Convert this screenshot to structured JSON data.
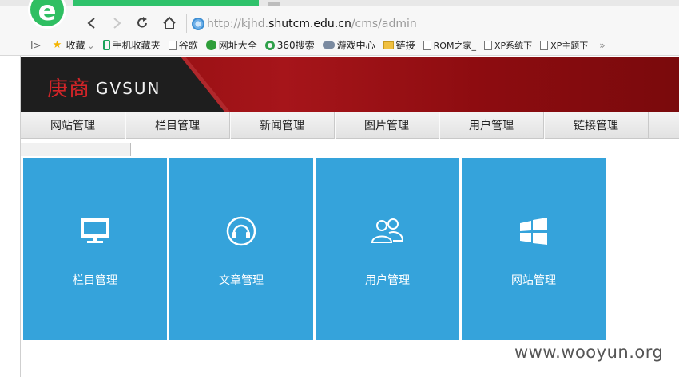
{
  "browser": {
    "back_icon": "chevron-left-icon",
    "forward_icon": "chevron-right-icon",
    "refresh_icon": "refresh-icon",
    "home_icon": "home-icon",
    "url_scheme": "http://",
    "url_sub": "kjhd.",
    "url_domain": "shutcm.edu.cn",
    "url_path": "/cms/admin"
  },
  "favorites": {
    "toggle": "I>",
    "items": [
      {
        "label": "收藏",
        "icon": "star-icon"
      },
      {
        "label": "手机收藏夹",
        "icon": "phone-icon"
      },
      {
        "label": "谷歌",
        "icon": "page-icon"
      },
      {
        "label": "网址大全",
        "icon": "globe-icon"
      },
      {
        "label": "360搜索",
        "icon": "search-ring-icon"
      },
      {
        "label": "游戏中心",
        "icon": "gamepad-icon"
      },
      {
        "label": "链接",
        "icon": "folder-icon"
      },
      {
        "label": "ROM之家_",
        "icon": "page-icon"
      },
      {
        "label": "XP系统下",
        "icon": "page-icon"
      },
      {
        "label": "XP主题下",
        "icon": "page-icon"
      }
    ],
    "more": "»"
  },
  "banner": {
    "brand_cn": "庚商",
    "brand_en": "GVSUN",
    "colors": {
      "red": "#a6151a",
      "dark": "#1e1e1e"
    }
  },
  "menu": {
    "items": [
      "网站管理",
      "栏目管理",
      "新闻管理",
      "图片管理",
      "用户管理",
      "链接管理"
    ]
  },
  "tiles": [
    {
      "label": "栏目管理",
      "icon": "monitor-icon"
    },
    {
      "label": "文章管理",
      "icon": "headset-icon"
    },
    {
      "label": "用户管理",
      "icon": "users-icon"
    },
    {
      "label": "网站管理",
      "icon": "windows-icon"
    }
  ],
  "tile_color": "#35a3db",
  "watermark": "www.wooyun.org"
}
